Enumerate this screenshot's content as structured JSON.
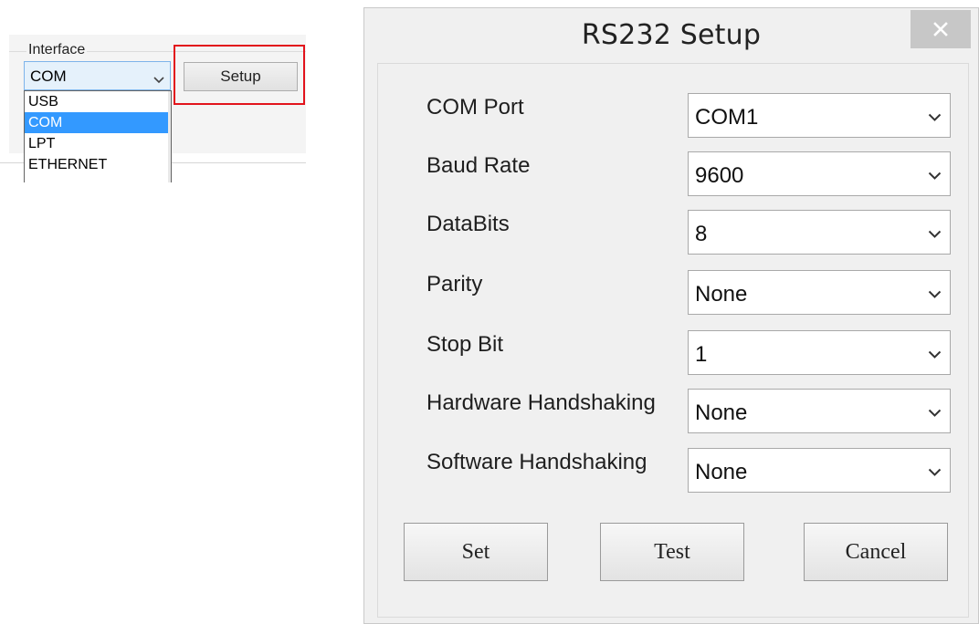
{
  "interface_panel": {
    "group_label": "Interface",
    "selected_value": "COM",
    "setup_button_label": "Setup",
    "options": [
      "USB",
      "COM",
      "LPT",
      "ETHERNET"
    ],
    "selected_option_index": 1,
    "highlight_color": "#e2131c"
  },
  "dialog": {
    "title": "RS232 Setup",
    "close_glyph": "×",
    "fields": [
      {
        "label": "COM Port",
        "value": "COM1"
      },
      {
        "label": "Baud Rate",
        "value": "9600"
      },
      {
        "label": "DataBits",
        "value": "8"
      },
      {
        "label": "Parity",
        "value": "None"
      },
      {
        "label": "Stop Bit",
        "value": "1"
      },
      {
        "label": "Hardware Handshaking",
        "value": "None"
      },
      {
        "label": "Software Handshaking",
        "value": "None"
      }
    ],
    "buttons": {
      "set": "Set",
      "test": "Test",
      "cancel": "Cancel"
    }
  },
  "colors": {
    "selection": "#3399ff",
    "close_button": "#c7c7c7",
    "dialog_bg": "#f0f0f0"
  },
  "icons": {
    "dropdown": "chevron-down-icon",
    "close": "close-icon"
  }
}
